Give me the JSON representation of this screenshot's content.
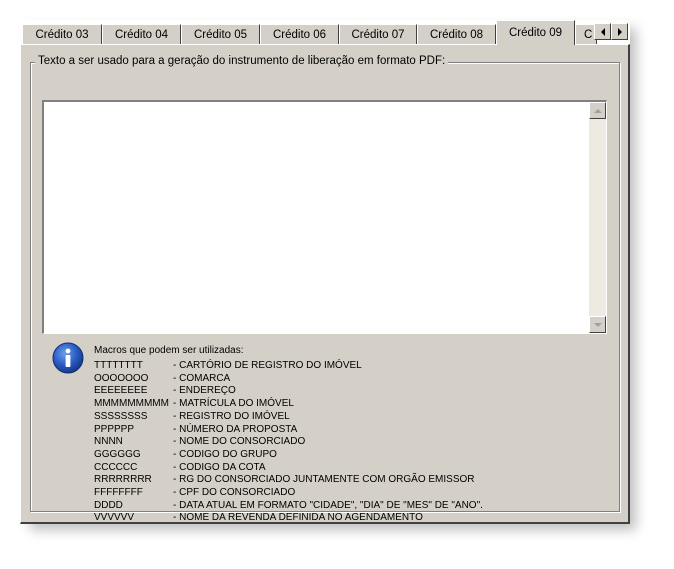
{
  "tabs": [
    {
      "label": "Crédito 03",
      "active": false
    },
    {
      "label": "Crédito 04",
      "active": false
    },
    {
      "label": "Crédito 05",
      "active": false
    },
    {
      "label": "Crédito 06",
      "active": false
    },
    {
      "label": "Crédito 07",
      "active": false
    },
    {
      "label": "Crédito 08",
      "active": false
    },
    {
      "label": "Crédito 09",
      "active": true
    },
    {
      "label": "C",
      "active": false
    }
  ],
  "tab_scroll": {
    "left_icon": "triangle-left-icon",
    "right_icon": "triangle-right-icon"
  },
  "fieldset": {
    "legend": "Texto a ser usado para a geração do instrumento de liberação em formato PDF:",
    "textarea_value": ""
  },
  "info": {
    "icon": "info-icon",
    "title": "Macros que podem ser utilizadas:",
    "macros": [
      {
        "code": "TTTTTTTT",
        "desc": "- CARTÓRIO DE REGISTRO DO IMÓVEL"
      },
      {
        "code": "OOOOOOO",
        "desc": "- COMARCA"
      },
      {
        "code": "EEEEEEEE",
        "desc": "- ENDEREÇO"
      },
      {
        "code": "MMMMMMMMM",
        "desc": "- MATRÍCULA DO IMÓVEL"
      },
      {
        "code": "SSSSSSSS",
        "desc": "- REGISTRO DO IMÓVEL"
      },
      {
        "code": "PPPPPP",
        "desc": "- NÚMERO DA PROPOSTA"
      },
      {
        "code": "NNNN",
        "desc": "- NOME DO CONSORCIADO"
      },
      {
        "code": "GGGGGG",
        "desc": "- CODIGO DO GRUPO"
      },
      {
        "code": "CCCCCC",
        "desc": "- CODIGO DA COTA"
      },
      {
        "code": "RRRRRRRR",
        "desc": "- RG DO CONSORCIADO JUNTAMENTE COM ORGÃO EMISSOR"
      },
      {
        "code": "FFFFFFFF",
        "desc": "- CPF DO CONSORCIADO"
      },
      {
        "code": "DDDD",
        "desc": "- DATA ATUAL EM FORMATO \"CIDADE\", \"DIA\" DE \"MES\" DE \"ANO\"."
      },
      {
        "code": "VVVVVV",
        "desc": "- NOME DA REVENDA DEFINIDA NO AGENDAMENTO"
      }
    ]
  },
  "colors": {
    "window_bg": "#d4d0c8",
    "info_blue": "#1f4fb0",
    "text": "#000000"
  }
}
